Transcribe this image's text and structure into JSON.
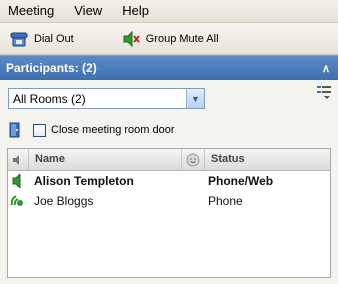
{
  "menu": {
    "items": [
      "Meeting",
      "View",
      "Help"
    ]
  },
  "toolbar": {
    "dial_out": "Dial Out",
    "group_mute": "Group Mute All"
  },
  "participants": {
    "title": "Participants: (2)"
  },
  "rooms": {
    "selected": "All Rooms  (2)"
  },
  "door": {
    "label": "Close meeting room door"
  },
  "grid": {
    "headers": {
      "name": "Name",
      "status": "Status"
    },
    "rows": [
      {
        "name": "Alison Templeton",
        "status": "Phone/Web",
        "bold": true,
        "icon": "speaker-icon"
      },
      {
        "name": "Joe Bloggs",
        "status": "Phone",
        "bold": false,
        "icon": "talking-icon"
      }
    ]
  },
  "colors": {
    "header_bg": "#4a7bbd",
    "panel_bg": "#f4f3ee",
    "accent_green": "#2e9a2e"
  }
}
